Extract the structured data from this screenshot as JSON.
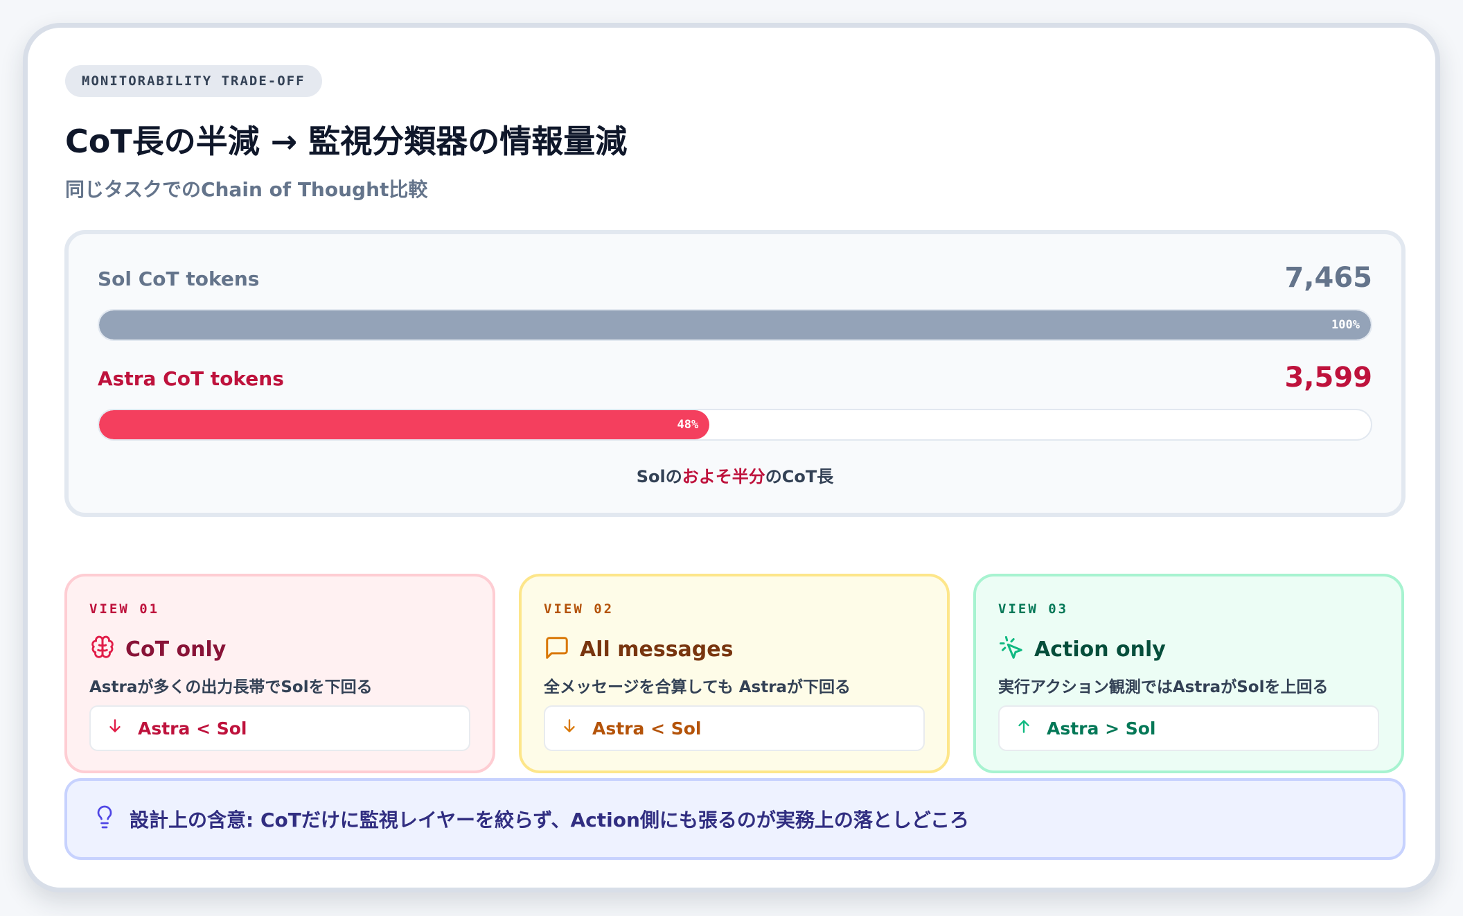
{
  "tag": "MONITORABILITY TRADE-OFF",
  "title": "CoT長の半減 → 監視分類器の情報量減",
  "subtitle": "同じタスクでのChain of Thought比較",
  "comparison": {
    "sol": {
      "label": "Sol CoT tokens",
      "value": "7,465",
      "percent_label": "100%",
      "fraction": 1.0,
      "color": "#94a3b8"
    },
    "astra": {
      "label": "Astra CoT tokens",
      "value": "3,599",
      "percent_label": "48%",
      "fraction": 0.48,
      "color": "#f43f5e"
    },
    "note_prefix": "Solの",
    "note_highlight": "およそ半分",
    "note_suffix": "のCoT長"
  },
  "views": [
    {
      "tag": "VIEW 01",
      "icon": "brain-icon",
      "title": "CoT only",
      "desc": "Astraが多くの出力長帯でSolを下回る",
      "result_icon": "arrow-down-icon",
      "result": "Astra < Sol",
      "color": "#be123c"
    },
    {
      "tag": "VIEW 02",
      "icon": "message-square-icon",
      "title": "All messages",
      "desc": "全メッセージを合算しても Astraが下回る",
      "result_icon": "arrow-down-icon",
      "result": "Astra < Sol",
      "color": "#b45309"
    },
    {
      "tag": "VIEW 03",
      "icon": "pointer-click-icon",
      "title": "Action only",
      "desc": "実行アクション観測ではAstraがSolを上回る",
      "result_icon": "arrow-up-icon",
      "result": "Astra > Sol",
      "color": "#047857"
    }
  ],
  "implication": {
    "icon": "lightbulb-icon",
    "text": "設計上の含意: CoTだけに監視レイヤーを絞らず、Action側にも張るのが実務上の落としどころ"
  }
}
